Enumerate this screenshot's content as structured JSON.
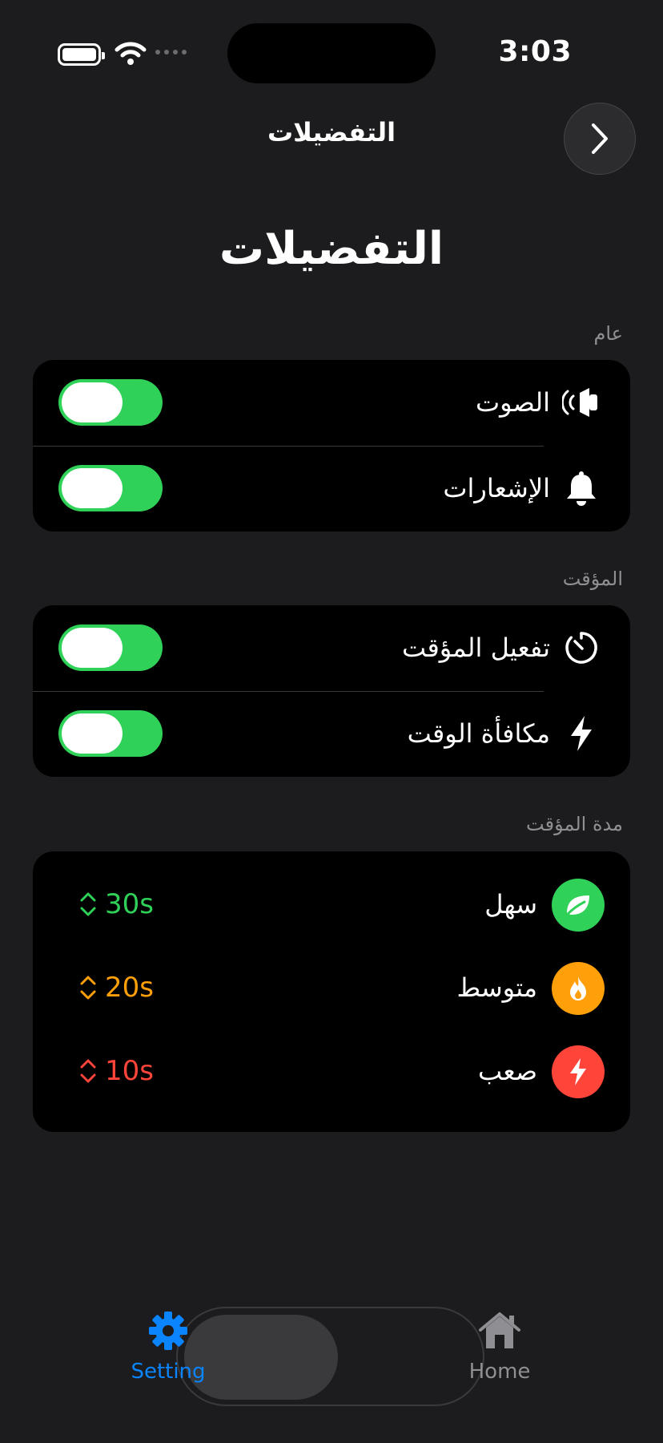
{
  "status_bar": {
    "time": "3:03",
    "battery_icon": "battery-icon",
    "wifi_icon": "wifi-icon"
  },
  "nav": {
    "title": "التفضيلات",
    "back_icon": "chevron-right-icon"
  },
  "page": {
    "large_title": "التفضيلات"
  },
  "sections": {
    "general": {
      "header": "عام",
      "rows": [
        {
          "label": "الصوت",
          "icon": "speaker-icon",
          "enabled": true
        },
        {
          "label": "الإشعارات",
          "icon": "bell-icon",
          "enabled": true
        }
      ]
    },
    "timer": {
      "header": "المؤقت",
      "rows": [
        {
          "label": "تفعيل المؤقت",
          "icon": "timer-icon",
          "enabled": true
        },
        {
          "label": "مكافأة الوقت",
          "icon": "bolt-icon",
          "enabled": true
        }
      ]
    },
    "duration": {
      "header": "مدة المؤقت",
      "rows": [
        {
          "label": "سهل",
          "value": "30s",
          "icon": "leaf-icon",
          "color": "#30d158"
        },
        {
          "label": "متوسط",
          "value": "20s",
          "icon": "flame-icon",
          "color": "#ff9f0a"
        },
        {
          "label": "صعب",
          "value": "10s",
          "icon": "bolt-icon",
          "color": "#ff453a"
        }
      ]
    }
  },
  "tab_bar": {
    "active_color": "#0a84ff",
    "tabs": [
      {
        "label": "Setting",
        "icon": "gear-icon",
        "active": true
      },
      {
        "label": "Home",
        "icon": "house-icon",
        "active": false
      }
    ]
  }
}
